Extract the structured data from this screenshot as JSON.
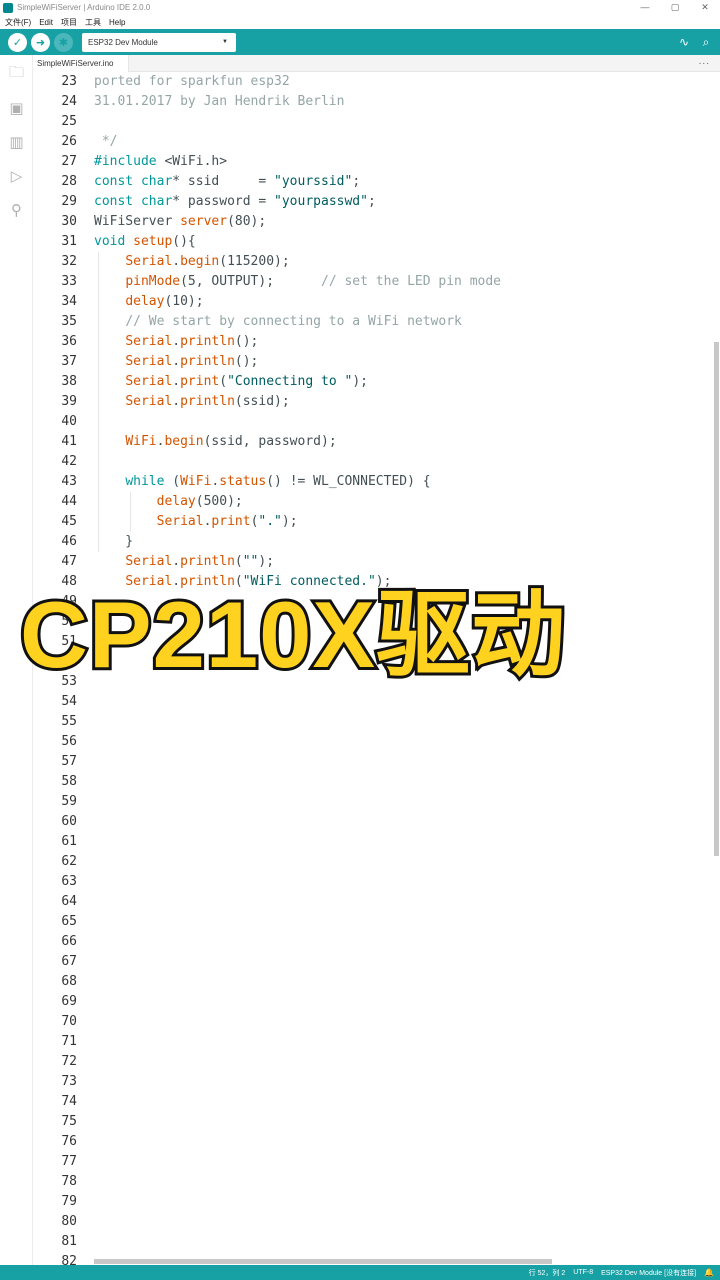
{
  "window": {
    "title": "SimpleWiFiServer | Arduino IDE 2.0.0",
    "controls": {
      "minimize": "—",
      "restore": "▢",
      "close": "✕"
    }
  },
  "menu": [
    "文件(F)",
    "Edit",
    "项目",
    "工具",
    "Help"
  ],
  "toolbar": {
    "verify_icon": "check-icon",
    "upload_icon": "arrow-right-icon",
    "debug_icon": "debug-icon",
    "board_select": "ESP32 Dev Module",
    "serial_plotter_icon": "plotter-icon",
    "serial_monitor_icon": "serial-monitor-icon"
  },
  "sidebar": [
    "folder-icon",
    "board-manager-icon",
    "library-icon",
    "debug-icon",
    "search-icon"
  ],
  "tabs": {
    "file": "SimpleWiFiServer.ino",
    "more": "..."
  },
  "code": {
    "lines": [
      {
        "n": "23",
        "parts": [
          [
            "c-comment",
            "ported for sparkfun esp32"
          ]
        ]
      },
      {
        "n": "24",
        "parts": [
          [
            "c-comment",
            "31.01.2017 by Jan Hendrik Berlin"
          ]
        ]
      },
      {
        "n": "25",
        "parts": []
      },
      {
        "n": "26",
        "parts": [
          [
            "c-comment",
            " */"
          ]
        ]
      },
      {
        "n": "27",
        "parts": [
          [
            "c-kw",
            "#include"
          ],
          [
            "c-txt",
            " <WiFi.h>"
          ]
        ]
      },
      {
        "n": "28",
        "parts": [
          [
            "c-kw",
            "const"
          ],
          [
            "c-txt",
            " "
          ],
          [
            "c-kw",
            "char"
          ],
          [
            "c-txt",
            "* ssid     = "
          ],
          [
            "c-str",
            "\"yourssid\""
          ],
          [
            "c-txt",
            ";"
          ]
        ]
      },
      {
        "n": "29",
        "parts": [
          [
            "c-kw",
            "const"
          ],
          [
            "c-txt",
            " "
          ],
          [
            "c-kw",
            "char"
          ],
          [
            "c-txt",
            "* password = "
          ],
          [
            "c-str",
            "\"yourpasswd\""
          ],
          [
            "c-txt",
            ";"
          ]
        ]
      },
      {
        "n": "30",
        "parts": [
          [
            "c-txt",
            "WiFiServer "
          ],
          [
            "c-fn",
            "server"
          ],
          [
            "c-txt",
            "(80);"
          ]
        ]
      },
      {
        "n": "31",
        "parts": [
          [
            "c-kw",
            "void"
          ],
          [
            "c-txt",
            " "
          ],
          [
            "c-fn",
            "setup"
          ],
          [
            "c-txt",
            "(){"
          ]
        ]
      },
      {
        "n": "32",
        "parts": [
          [
            "c-txt",
            "    "
          ],
          [
            "c-fn",
            "Serial"
          ],
          [
            "c-txt",
            "."
          ],
          [
            "c-fn",
            "begin"
          ],
          [
            "c-txt",
            "(115200);"
          ]
        ]
      },
      {
        "n": "33",
        "parts": [
          [
            "c-txt",
            "    "
          ],
          [
            "c-fn",
            "pinMode"
          ],
          [
            "c-txt",
            "(5, OUTPUT);      "
          ],
          [
            "c-comment",
            "// set the LED pin mode"
          ]
        ]
      },
      {
        "n": "34",
        "parts": [
          [
            "c-txt",
            "    "
          ],
          [
            "c-fn",
            "delay"
          ],
          [
            "c-txt",
            "(10);"
          ]
        ]
      },
      {
        "n": "35",
        "parts": [
          [
            "c-txt",
            "    "
          ],
          [
            "c-comment",
            "// We start by connecting to a WiFi network"
          ]
        ]
      },
      {
        "n": "36",
        "parts": [
          [
            "c-txt",
            "    "
          ],
          [
            "c-fn",
            "Serial"
          ],
          [
            "c-txt",
            "."
          ],
          [
            "c-fn",
            "println"
          ],
          [
            "c-txt",
            "();"
          ]
        ]
      },
      {
        "n": "37",
        "parts": [
          [
            "c-txt",
            "    "
          ],
          [
            "c-fn",
            "Serial"
          ],
          [
            "c-txt",
            "."
          ],
          [
            "c-fn",
            "println"
          ],
          [
            "c-txt",
            "();"
          ]
        ]
      },
      {
        "n": "38",
        "parts": [
          [
            "c-txt",
            "    "
          ],
          [
            "c-fn",
            "Serial"
          ],
          [
            "c-txt",
            "."
          ],
          [
            "c-fn",
            "print"
          ],
          [
            "c-txt",
            "("
          ],
          [
            "c-str",
            "\"Connecting to \""
          ],
          [
            "c-txt",
            ");"
          ]
        ]
      },
      {
        "n": "39",
        "parts": [
          [
            "c-txt",
            "    "
          ],
          [
            "c-fn",
            "Serial"
          ],
          [
            "c-txt",
            "."
          ],
          [
            "c-fn",
            "println"
          ],
          [
            "c-txt",
            "(ssid);"
          ]
        ]
      },
      {
        "n": "40",
        "parts": []
      },
      {
        "n": "41",
        "parts": [
          [
            "c-txt",
            "    "
          ],
          [
            "c-fn",
            "WiFi"
          ],
          [
            "c-txt",
            "."
          ],
          [
            "c-fn",
            "begin"
          ],
          [
            "c-txt",
            "(ssid, password);"
          ]
        ]
      },
      {
        "n": "42",
        "parts": []
      },
      {
        "n": "43",
        "parts": [
          [
            "c-txt",
            "    "
          ],
          [
            "c-kw",
            "while"
          ],
          [
            "c-txt",
            " ("
          ],
          [
            "c-fn",
            "WiFi"
          ],
          [
            "c-txt",
            "."
          ],
          [
            "c-fn",
            "status"
          ],
          [
            "c-txt",
            "() != WL_CONNECTED) {"
          ]
        ]
      },
      {
        "n": "44",
        "parts": [
          [
            "c-txt",
            "        "
          ],
          [
            "c-fn",
            "delay"
          ],
          [
            "c-txt",
            "(500);"
          ]
        ]
      },
      {
        "n": "45",
        "parts": [
          [
            "c-txt",
            "        "
          ],
          [
            "c-fn",
            "Serial"
          ],
          [
            "c-txt",
            "."
          ],
          [
            "c-fn",
            "print"
          ],
          [
            "c-txt",
            "("
          ],
          [
            "c-str",
            "\".\""
          ],
          [
            "c-txt",
            ");"
          ]
        ]
      },
      {
        "n": "46",
        "parts": [
          [
            "c-txt",
            "    }"
          ]
        ]
      },
      {
        "n": "47",
        "parts": [
          [
            "c-txt",
            "    "
          ],
          [
            "c-fn",
            "Serial"
          ],
          [
            "c-txt",
            "."
          ],
          [
            "c-fn",
            "println"
          ],
          [
            "c-txt",
            "("
          ],
          [
            "c-str",
            "\"\""
          ],
          [
            "c-txt",
            ");"
          ]
        ]
      },
      {
        "n": "48",
        "parts": [
          [
            "c-txt",
            "    "
          ],
          [
            "c-fn",
            "Serial"
          ],
          [
            "c-txt",
            "."
          ],
          [
            "c-fn",
            "println"
          ],
          [
            "c-txt",
            "("
          ],
          [
            "c-str",
            "\"WiFi connected.\""
          ],
          [
            "c-txt",
            ");"
          ]
        ]
      },
      {
        "n": "49",
        "parts": []
      },
      {
        "n": "50",
        "parts": []
      },
      {
        "n": "51",
        "parts": []
      },
      {
        "n": "52",
        "parts": []
      },
      {
        "n": "53",
        "parts": []
      },
      {
        "n": "54",
        "parts": []
      },
      {
        "n": "55",
        "parts": []
      },
      {
        "n": "56",
        "parts": []
      },
      {
        "n": "57",
        "parts": []
      },
      {
        "n": "58",
        "parts": []
      },
      {
        "n": "59",
        "parts": []
      },
      {
        "n": "60",
        "parts": []
      },
      {
        "n": "61",
        "parts": []
      },
      {
        "n": "62",
        "parts": []
      },
      {
        "n": "63",
        "parts": []
      },
      {
        "n": "64",
        "parts": []
      },
      {
        "n": "65",
        "parts": []
      },
      {
        "n": "66",
        "parts": []
      },
      {
        "n": "67",
        "parts": []
      },
      {
        "n": "68",
        "parts": []
      },
      {
        "n": "69",
        "parts": []
      },
      {
        "n": "70",
        "parts": []
      },
      {
        "n": "71",
        "parts": []
      },
      {
        "n": "72",
        "parts": []
      },
      {
        "n": "73",
        "parts": []
      },
      {
        "n": "74",
        "parts": []
      },
      {
        "n": "75",
        "parts": []
      },
      {
        "n": "76",
        "parts": []
      },
      {
        "n": "77",
        "parts": []
      },
      {
        "n": "78",
        "parts": []
      },
      {
        "n": "79",
        "parts": []
      },
      {
        "n": "80",
        "parts": []
      },
      {
        "n": "81",
        "parts": []
      },
      {
        "n": "82",
        "parts": []
      }
    ]
  },
  "overlay_caption": "CP210X驱动",
  "status": {
    "position": "行 52，列 2",
    "encoding": "UTF-8",
    "board": "ESP32 Dev Module [没有连接]",
    "bell_icon": "bell-icon"
  },
  "colors": {
    "accent": "#17a1a5",
    "caption_fill": "#ffd21f",
    "caption_stroke": "#111111"
  }
}
